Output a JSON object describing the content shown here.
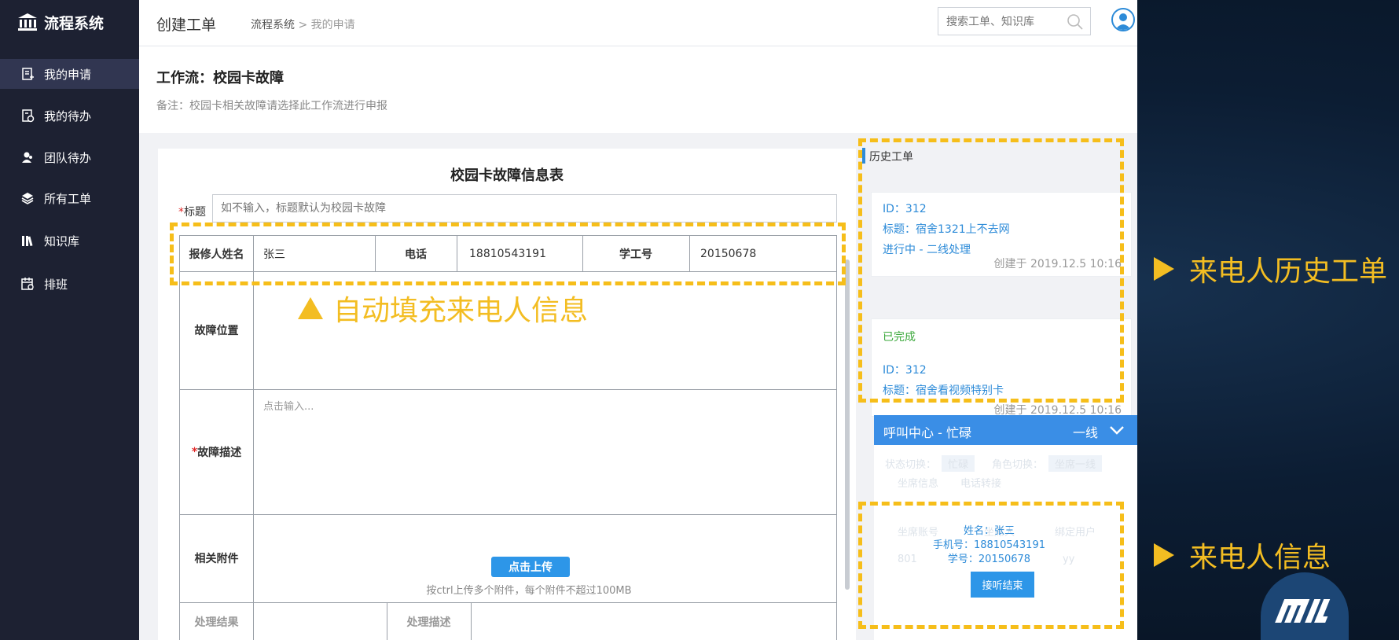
{
  "sidebar": {
    "app_name": "流程系统",
    "items": [
      {
        "label": "我的申请",
        "icon": "document-icon",
        "active": true
      },
      {
        "label": "我的待办",
        "icon": "todo-icon",
        "active": false
      },
      {
        "label": "团队待办",
        "icon": "team-icon",
        "active": false
      },
      {
        "label": "所有工单",
        "icon": "layers-icon",
        "active": false
      },
      {
        "label": "知识库",
        "icon": "library-icon",
        "active": false
      },
      {
        "label": "排班",
        "icon": "calendar-icon",
        "active": false
      }
    ]
  },
  "header": {
    "title": "创建工单",
    "breadcrumb": {
      "root": "流程系统",
      "sep": ">",
      "current": "我的申请"
    },
    "search_placeholder": "搜索工单、知识库"
  },
  "workflow": {
    "title": "工作流：校园卡故障",
    "note": "备注：校园卡相关故障请选择此工作流进行申报"
  },
  "form": {
    "title": "校园卡故障信息表",
    "title_field": {
      "required_mark": "*",
      "label": "标题",
      "placeholder": "如不输入，标题默认为校园卡故障"
    },
    "reporter_label": "报修人姓名",
    "reporter_value": "张三",
    "phone_label": "电话",
    "phone_value": "18810543191",
    "id_label": "学工号",
    "id_value": "20150678",
    "location_label": "故障位置",
    "desc_label": "故障描述",
    "desc_required_mark": "*",
    "desc_placeholder": "点击输入...",
    "attach_label": "相关附件",
    "upload_button": "点击上传",
    "upload_hint": "按ctrl上传多个附件，每个附件不超过100MB",
    "result_label": "处理结果",
    "process_desc_label": "处理描述"
  },
  "history": {
    "title": "历史工单",
    "tickets": [
      {
        "id": "ID：312",
        "subject": "标题：宿舍1321上不去网",
        "status": "进行中 - 二线处理",
        "created": "创建于 2019.12.5  10:16"
      },
      {
        "group": "已完成",
        "id": "ID：312",
        "subject": "标题：宿舍看视频特别卡",
        "created": "创建于 2019.12.5  10:16"
      }
    ]
  },
  "call_center": {
    "title": "呼叫中心 - 忙碌",
    "line": "一线",
    "ghost": {
      "state_label": "状态切换：",
      "state_value": "忙碌",
      "role_label": "角色切换：",
      "role_value": "坐席一线",
      "tab1": "坐席信息",
      "tab2": "电话转接",
      "col1": "坐席账号",
      "col2": "坐席人",
      "col3": "绑定用户",
      "row_account": "801",
      "row_user": "yy"
    },
    "caller": {
      "name": "姓名：张三",
      "mobile": "手机号：18810543191",
      "student_id": "学号：20150678",
      "end_button": "接听结束"
    }
  },
  "annotations": {
    "autofill": "自动填充来电人信息",
    "history": "来电人历史工单",
    "caller_info": "来电人信息",
    "brand": "MIT"
  },
  "colors": {
    "sidebar": "#1d2132",
    "accent": "#2d8bd8",
    "annotation": "#f6be1a",
    "call_bar": "#3a8ee6"
  }
}
